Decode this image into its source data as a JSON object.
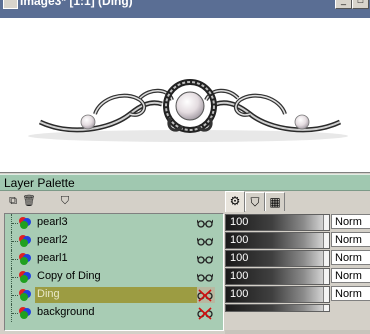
{
  "window": {
    "title": "Image3* [1:1] (Ding)"
  },
  "palette": {
    "title": "Layer Palette",
    "layers": [
      {
        "name": "pearl3",
        "visible": true,
        "selected": false
      },
      {
        "name": "pearl2",
        "visible": true,
        "selected": false
      },
      {
        "name": "pearl1",
        "visible": true,
        "selected": false
      },
      {
        "name": "Copy of Ding",
        "visible": true,
        "selected": false
      },
      {
        "name": "Ding",
        "visible": false,
        "selected": true
      },
      {
        "name": "background",
        "visible": false,
        "selected": false
      }
    ],
    "rows": [
      {
        "opacity": "100",
        "blend": "Norm"
      },
      {
        "opacity": "100",
        "blend": "Norm"
      },
      {
        "opacity": "100",
        "blend": "Norm"
      },
      {
        "opacity": "100",
        "blend": "Norm"
      },
      {
        "opacity": "100",
        "blend": "Norm"
      },
      {
        "opacity": "",
        "blend": ""
      }
    ]
  },
  "colors": {
    "palette_title_bg": "#a0c8b0",
    "list_bg": "#a8ccb4",
    "selected_row": "#9c9c42",
    "window_title_bg": "#5a6e94"
  }
}
